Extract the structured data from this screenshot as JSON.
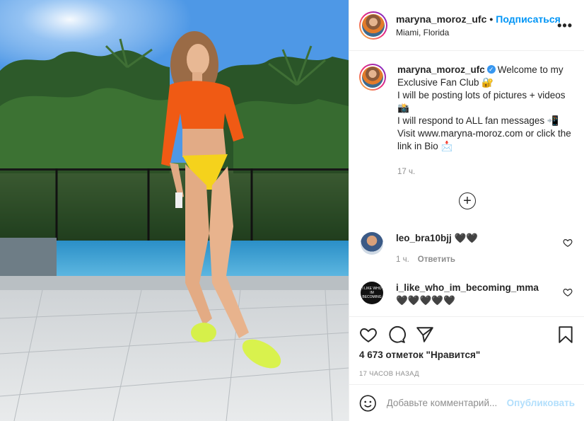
{
  "colors": {
    "accent": "#0095f6",
    "muted": "#8e8e8e",
    "publish_disabled": "#b2dffc"
  },
  "header": {
    "username": "maryna_moroz_ufc",
    "separator": "•",
    "follow_label": "Подписаться",
    "location": "Miami, Florida",
    "more_label": "•••"
  },
  "caption": {
    "username": "maryna_moroz_ufc",
    "verified_icon": "verified-badge",
    "lines": [
      "Welcome to my Exclusive Fan Club 🔐",
      "I will be posting lots of pictures + videos 📸",
      "I will respond to ALL fan messages 📲",
      "Visit www.maryna-moroz.com or click the link in Bio 📩"
    ],
    "time": "17 ч."
  },
  "load_more_label": "+",
  "comments": [
    {
      "username": "leo_bra10bjj",
      "text": "🖤🖤",
      "time": "1 ч.",
      "reply_label": "Ответить"
    },
    {
      "username": "i_like_who_im_becoming_mma",
      "text": "🖤🖤🖤🖤🖤"
    }
  ],
  "actions": {
    "like_icon": "heart-icon",
    "comment_icon": "comment-icon",
    "share_icon": "paper-plane-icon",
    "save_icon": "bookmark-icon",
    "likes_text": "4 673 отметок \"Нравится\"",
    "posted_ago": "17 ЧАСОВ НАЗАД"
  },
  "add_comment": {
    "placeholder": "Добавьте комментарий...",
    "publish_label": "Опубликовать"
  }
}
